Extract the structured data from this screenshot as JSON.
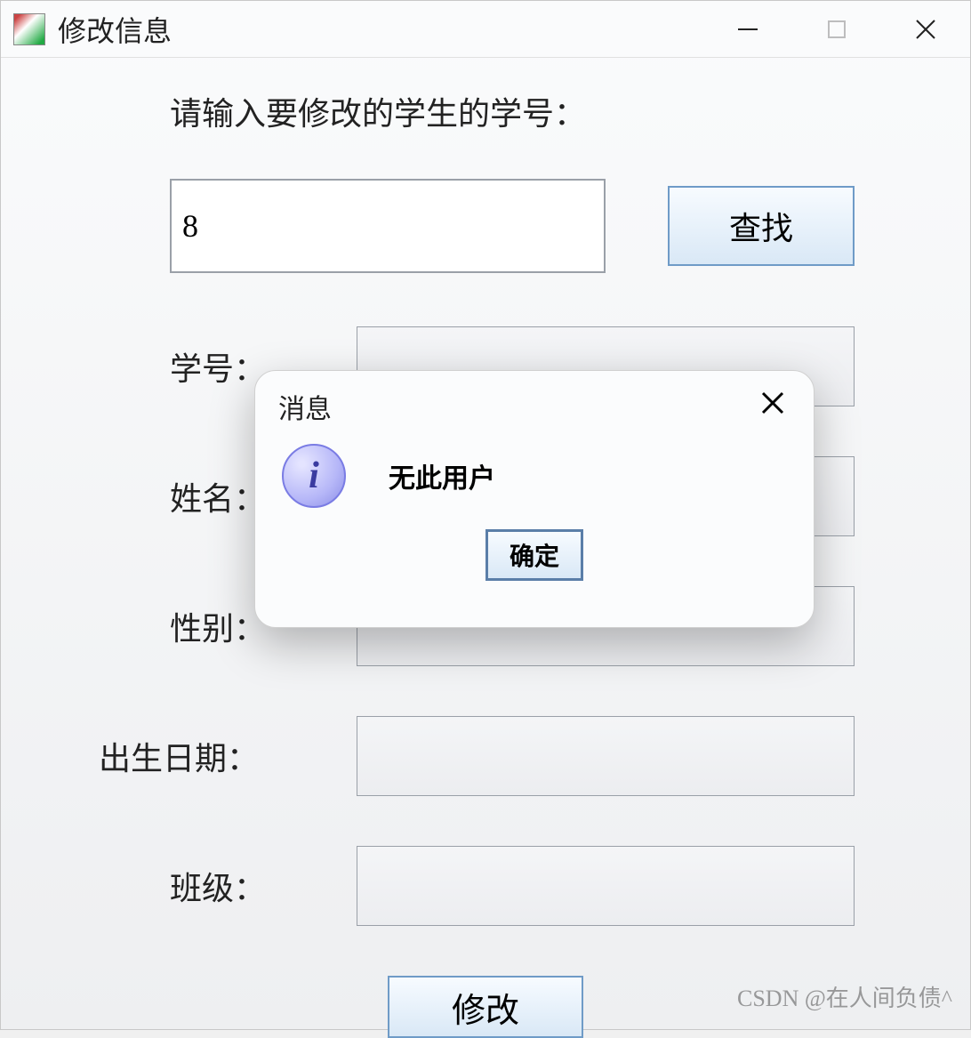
{
  "window": {
    "title": "修改信息",
    "icon_name": "app-icon"
  },
  "prompt": "请输入要修改的学生的学号：",
  "search": {
    "value": "8",
    "button": "查找"
  },
  "fields": {
    "student_id": {
      "label": "学号：",
      "value": ""
    },
    "name": {
      "label": "姓名：",
      "value": ""
    },
    "gender": {
      "label": "性别：",
      "value": ""
    },
    "birthdate": {
      "label": "出生日期：",
      "value": ""
    },
    "class": {
      "label": "班级：",
      "value": ""
    }
  },
  "submit_button": "修改",
  "dialog": {
    "title": "消息",
    "message": "无此用户",
    "ok": "确定",
    "icon": "info-icon"
  },
  "watermark": "CSDN @在人间负债^"
}
